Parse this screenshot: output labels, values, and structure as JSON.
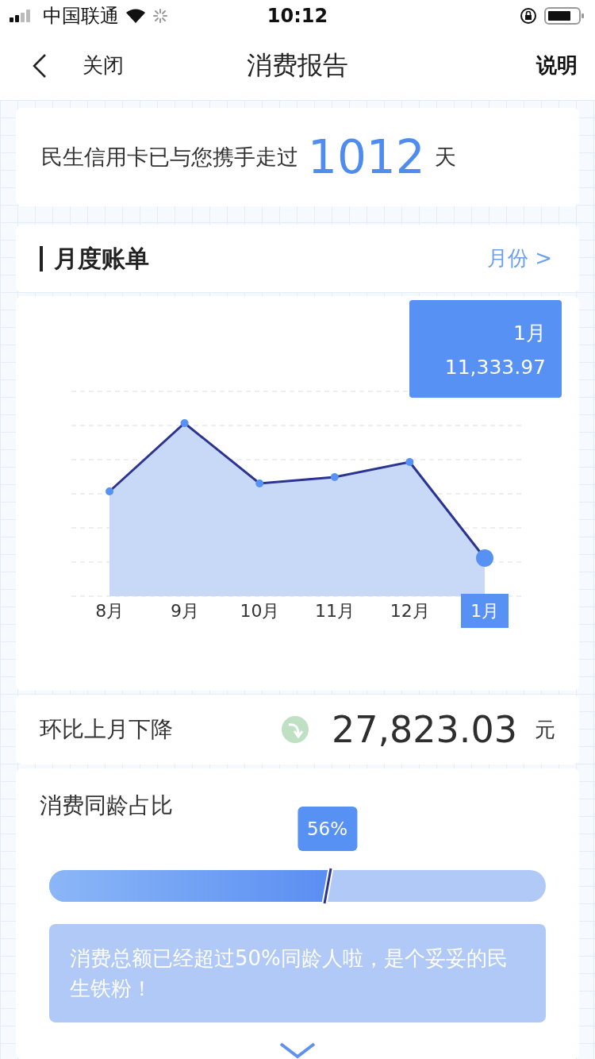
{
  "status_bar": {
    "carrier": "中国联通",
    "time": "10:12"
  },
  "nav": {
    "back_label": "关闭",
    "title": "消费报告",
    "action": "说明"
  },
  "days_card": {
    "prefix": "民生信用卡已与您携手走过",
    "days": "1012",
    "suffix": "天"
  },
  "monthly_bill": {
    "title": "月度账单",
    "month_link": "月份 >",
    "tooltip": {
      "month": "1月",
      "amount": "11,333.97"
    },
    "months": [
      {
        "label": "8月",
        "selected": false
      },
      {
        "label": "9月",
        "selected": false
      },
      {
        "label": "10月",
        "selected": false
      },
      {
        "label": "11月",
        "selected": false
      },
      {
        "label": "12月",
        "selected": false
      },
      {
        "label": "1月",
        "selected": true
      }
    ]
  },
  "change": {
    "label": "环比上月下降",
    "amount": "27,823.03",
    "unit": "元"
  },
  "peer": {
    "title": "消费同龄占比",
    "percent": "56%",
    "level": 0.56,
    "message": "消费总额已经超过50%同龄人啦，是个妥妥的民生铁粉！"
  }
}
